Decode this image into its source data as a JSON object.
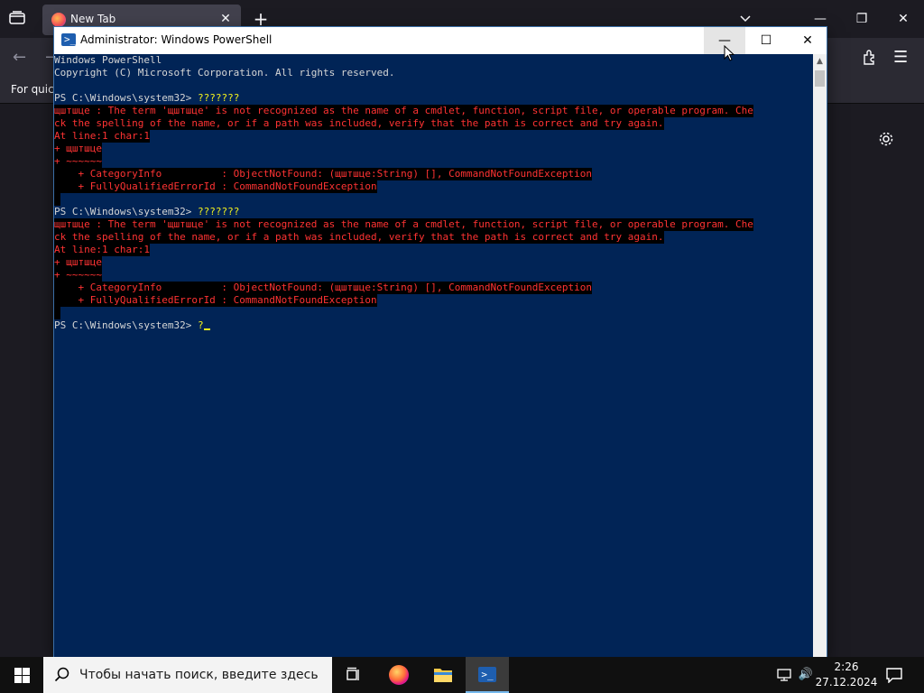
{
  "firefox": {
    "tab_title": "New Tab",
    "tab_close": "✕",
    "new_tab": "+",
    "bookmarks_text": "For quick",
    "win_minimize": "—",
    "win_restore": "❐",
    "win_close": "✕"
  },
  "powershell": {
    "title": "Administrator: Windows PowerShell",
    "minimize": "—",
    "maximize": "☐",
    "close": "✕",
    "lines": [
      {
        "text": "Windows PowerShell",
        "type": "normal"
      },
      {
        "text": "Copyright (C) Microsoft Corporation. All rights reserved.",
        "type": "normal"
      },
      {
        "text": "",
        "type": "blank"
      },
      {
        "prompt": "PS C:\\Windows\\system32> ",
        "cmd": "???????",
        "type": "prompt"
      },
      {
        "text": "щштшце : The term 'щштшце' is not recognized as the name of a cmdlet, function, script file, or operable program. Che",
        "type": "error"
      },
      {
        "text": "ck the spelling of the name, or if a path was included, verify that the path is correct and try again.",
        "type": "error"
      },
      {
        "text": "At line:1 char:1",
        "type": "error"
      },
      {
        "text": "+ щштшце",
        "type": "error"
      },
      {
        "text": "+ ~~~~~~",
        "type": "error"
      },
      {
        "text": "    + CategoryInfo          : ObjectNotFound: (щштшце:String) [], CommandNotFoundException",
        "type": "error"
      },
      {
        "text": "    + FullyQualifiedErrorId : CommandNotFoundException",
        "type": "error"
      },
      {
        "text": " ",
        "type": "errorblank"
      },
      {
        "prompt": "PS C:\\Windows\\system32> ",
        "cmd": "???????",
        "type": "prompt"
      },
      {
        "text": "щштшце : The term 'щштшце' is not recognized as the name of a cmdlet, function, script file, or operable program. Che",
        "type": "error"
      },
      {
        "text": "ck the spelling of the name, or if a path was included, verify that the path is correct and try again.",
        "type": "error"
      },
      {
        "text": "At line:1 char:1",
        "type": "error"
      },
      {
        "text": "+ щштшце",
        "type": "error"
      },
      {
        "text": "+ ~~~~~~",
        "type": "error"
      },
      {
        "text": "    + CategoryInfo          : ObjectNotFound: (щштшце:String) [], CommandNotFoundException",
        "type": "error"
      },
      {
        "text": "    + FullyQualifiedErrorId : CommandNotFoundException",
        "type": "error"
      },
      {
        "text": " ",
        "type": "errorblank"
      },
      {
        "prompt": "PS C:\\Windows\\system32> ",
        "cmd": "?",
        "type": "prompt"
      }
    ]
  },
  "taskbar": {
    "search_placeholder": "Чтобы начать поиск, введите здесь",
    "time": "2:26",
    "date": "27.12.2024",
    "volume_icon": "🔊"
  }
}
